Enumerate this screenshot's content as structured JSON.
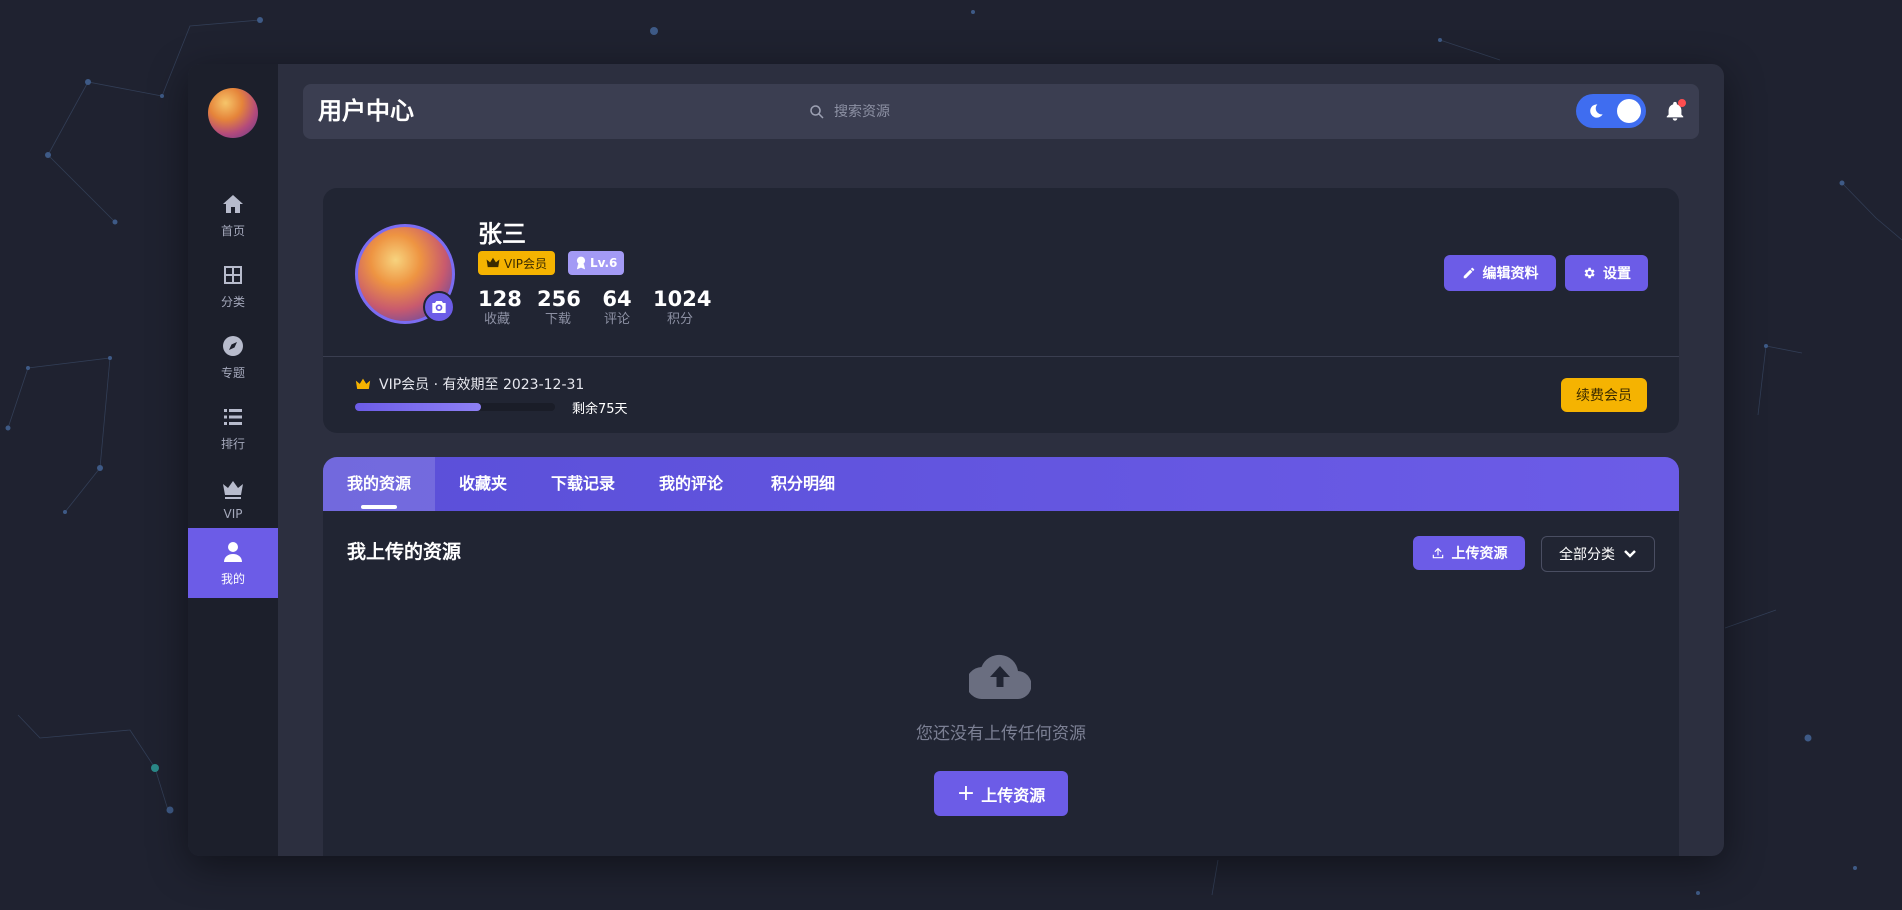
{
  "header": {
    "title": "用户中心",
    "search_placeholder": "搜索资源",
    "theme_icon": "moon-icon",
    "notification_icon": "bell-icon"
  },
  "sidebar": {
    "items": [
      {
        "label": "首页",
        "icon": "home-icon"
      },
      {
        "label": "分类",
        "icon": "grid-icon"
      },
      {
        "label": "专题",
        "icon": "compass-icon"
      },
      {
        "label": "排行",
        "icon": "list-icon"
      },
      {
        "label": "VIP",
        "icon": "crown-icon"
      },
      {
        "label": "我的",
        "icon": "user-icon",
        "active": true
      }
    ]
  },
  "profile": {
    "name": "张三",
    "vip_badge": "VIP会员",
    "level_badge": "Lv.6",
    "stats": [
      {
        "value": "128",
        "label": "收藏"
      },
      {
        "value": "256",
        "label": "下载"
      },
      {
        "value": "64",
        "label": "评论"
      },
      {
        "value": "1024",
        "label": "积分"
      }
    ],
    "edit_label": "编辑资料",
    "settings_label": "设置",
    "vip_status": "VIP会员 · 有效期至 2023-12-31",
    "vip_progress": 0.63,
    "vip_remaining": "剩余75天",
    "renew_label": "续费会员"
  },
  "tabs": [
    {
      "label": "我的资源",
      "active": true
    },
    {
      "label": "收藏夹"
    },
    {
      "label": "下载记录"
    },
    {
      "label": "我的评论"
    },
    {
      "label": "积分明细"
    }
  ],
  "resources": {
    "title": "我上传的资源",
    "upload_label": "上传资源",
    "category_filter": "全部分类",
    "empty_text": "您还没有上传任何资源",
    "empty_upload_label": "上传资源"
  },
  "colors": {
    "accent": "#6c5ce7",
    "gold": "#f5b301",
    "toggle_blue": "#3f6df0"
  }
}
